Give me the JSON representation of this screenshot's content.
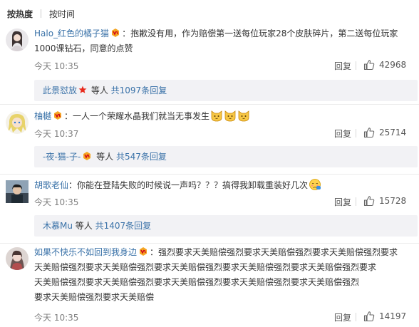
{
  "sort": {
    "hot_label": "按热度",
    "time_label": "按时间"
  },
  "comments": [
    {
      "user": "Halo_红色的橘子猫",
      "text_line1": "：抱歉没有用，作为赔偿第一送每位玩家28个皮肤碎片，第二送每位玩家",
      "text_line2": "1000课钻石，同意的点赞",
      "time": "今天 10:35",
      "reply": "回复",
      "likes": "42968",
      "sub_user": "此景怼放",
      "sub_rest": " 等人 ",
      "sub_count": "共1097条回复"
    },
    {
      "user": "柚樾",
      "text_line1": "：一人一个荣耀水晶我们就当无事发生",
      "time": "今天 10:37",
      "reply": "回复",
      "likes": "25714",
      "sub_user": "-夜-猫-子-",
      "sub_rest": " 等人 ",
      "sub_count": "共547条回复"
    },
    {
      "user": "胡歌老仙",
      "text_line1": "：你能在登陆失败的时候说一声吗？？？搞得我卸载重装好几次",
      "time": "今天 10:35",
      "reply": "回复",
      "likes": "15728",
      "sub_user": "木慕Mu",
      "sub_rest": " 等人 ",
      "sub_count": "共1407条回复"
    },
    {
      "user": "如果不快乐不如回到我身边",
      "text_line1": "：强烈要求天美赔偿强烈要求天美赔偿强烈要求天美赔偿强烈要求",
      "text_line2": "天美赔偿强烈要求天美赔偿强烈要求天美赔偿强烈要求天美赔偿强烈要求天美赔偿强烈要求",
      "text_line3": "天美赔偿强烈要求天美赔偿强烈要求天美赔偿强烈要求天美赔偿强烈要求天美赔偿强烈",
      "text_line4": "要求天美赔偿强烈要求天美赔偿",
      "time": "今天 10:35",
      "reply": "回复",
      "likes": "14197"
    }
  ],
  "icons": {
    "vip": "vip-badge-icon",
    "like": "thumbs-up-icon",
    "star": "red-star-icon",
    "emoji_cat": "cat-face-emoji",
    "emoji_shy": "shy-face-emoji"
  },
  "colors": {
    "user_orange": "#eb7350",
    "link_blue": "#3a72a8",
    "sub_bg": "#f2f2f5"
  }
}
